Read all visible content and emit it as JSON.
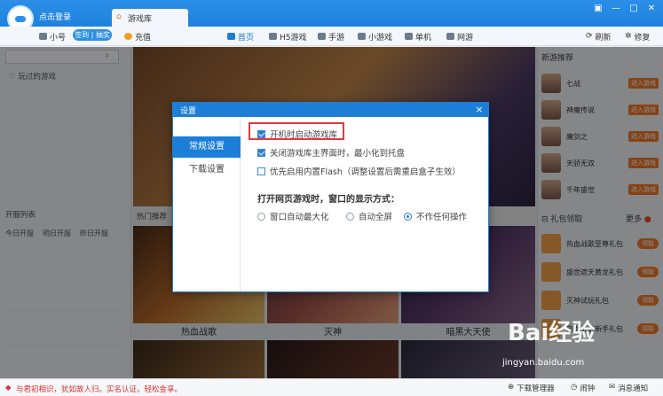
{
  "app": {
    "login_text": "点击登录",
    "tab_title": "游戏库",
    "user_label": "小号",
    "sign_label": "签到 | 抽奖",
    "recharge_label": "充值",
    "nav": [
      "首页",
      "H5游戏",
      "手游",
      "小游戏",
      "单机",
      "网游"
    ],
    "refresh_label": "刷新",
    "repair_label": "修复",
    "window_controls": [
      "▣",
      "—",
      "□",
      "✕"
    ]
  },
  "left": {
    "played_label": "玩过的游戏",
    "hot_label": "开服列表",
    "server_tabs": [
      "今日开服",
      "明日开服",
      "昨日开服"
    ]
  },
  "center": {
    "hot_label": "热门推荐",
    "thumb_labels": [
      "热血战歌",
      "灭神",
      "暗黑大天使"
    ]
  },
  "right": {
    "title": "新游推荐",
    "games": [
      "七战",
      "神魔传说",
      "魔剑之",
      "天骄无双",
      "千年盛世"
    ],
    "go_label": "进入游戏",
    "gift_title": "礼包领取",
    "more_label": "更多",
    "gifts": [
      "热血战歌至尊礼包",
      "盛世遮天黄龙礼包",
      "灭神试玩礼包",
      "热血战歌新手礼包"
    ],
    "gift_btn": "领取"
  },
  "dialog": {
    "title": "设置",
    "close": "×",
    "tabs": [
      "常规设置",
      "下载设置"
    ],
    "options": [
      {
        "label": "开机时启动游戏库",
        "checked": true
      },
      {
        "label": "关闭游戏库主界面时，最小化到托盘",
        "checked": true
      },
      {
        "label": "优先启用内置Flash（调整设置后需重启盒子生效）",
        "checked": false
      }
    ],
    "display_heading": "打开网页游戏时，窗口的显示方式：",
    "radios": [
      {
        "label": "窗口自动最大化",
        "selected": false
      },
      {
        "label": "自动全屏",
        "selected": false
      },
      {
        "label": "不作任何操作",
        "selected": true
      }
    ]
  },
  "status": {
    "notice": "与君初相识，犹如故人归。实名认证，轻松金享。",
    "download_mgr": "下载管理器",
    "alarm": "闹钟",
    "messages": "消息通知"
  },
  "watermark": {
    "brand": "Bai经验",
    "url": "jingyan.baidu.com"
  }
}
